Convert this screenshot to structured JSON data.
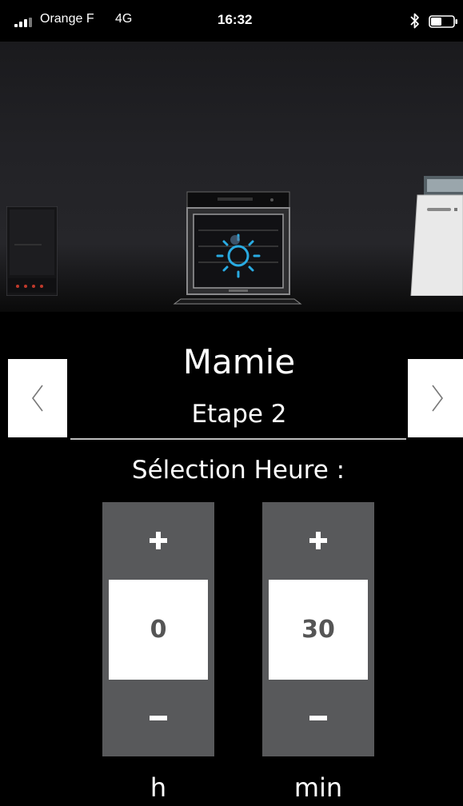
{
  "status_bar": {
    "carrier": "Orange F",
    "network": "4G",
    "time": "16:32",
    "icons": [
      "signal-bars-icon",
      "bluetooth-icon",
      "battery-icon"
    ]
  },
  "appliances": [
    "induction-hob",
    "oven",
    "dishwasher"
  ],
  "recipe": {
    "name": "Mamie",
    "step": "Etape 2"
  },
  "navigation": {
    "prev_icon": "chevron-left-icon",
    "next_icon": "chevron-right-icon"
  },
  "time_selection": {
    "title": "Sélection Heure :",
    "hours": {
      "value": "0",
      "unit": "h"
    },
    "minutes": {
      "value": "30",
      "unit": "min"
    }
  },
  "colors": {
    "background": "#000000",
    "stepper": "#58595b",
    "accent": "#29abe2"
  }
}
